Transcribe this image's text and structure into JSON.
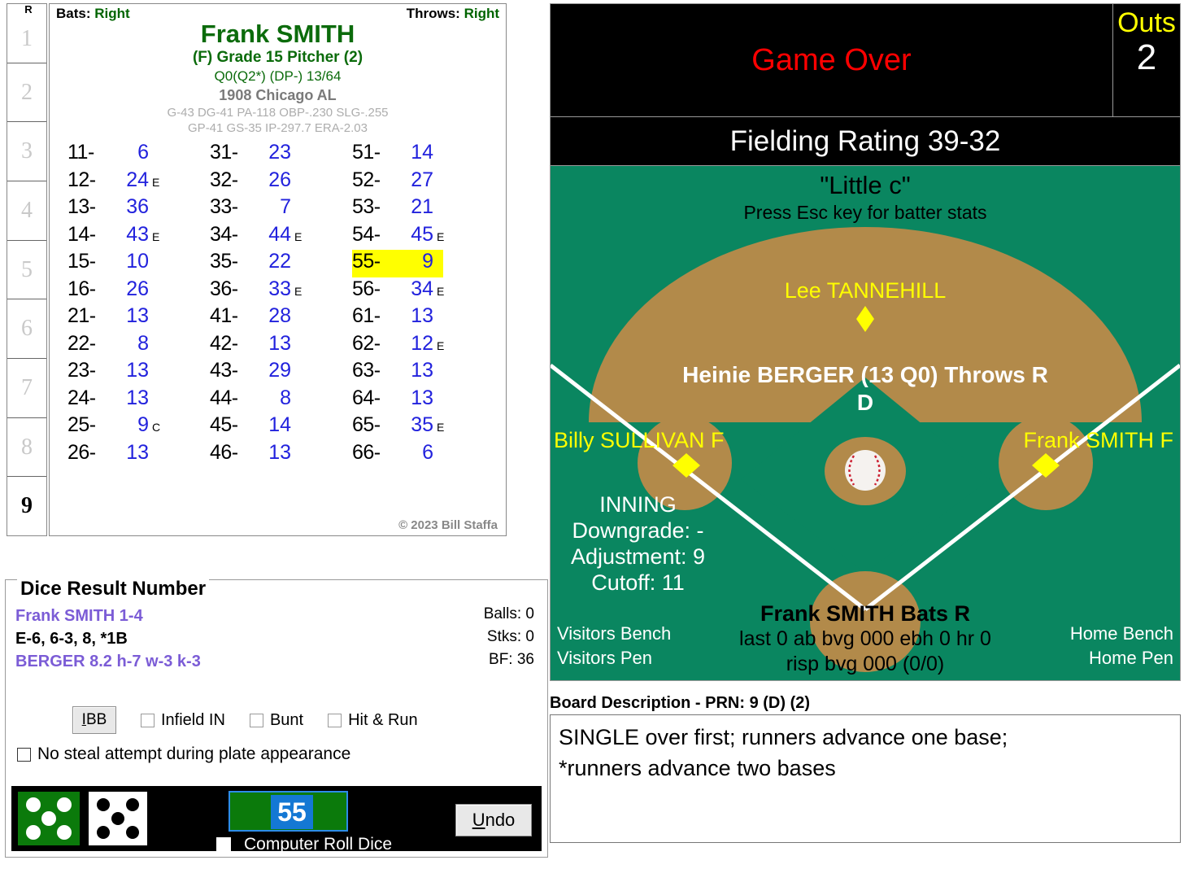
{
  "card": {
    "inning_header": "R",
    "innings": [
      "1",
      "2",
      "3",
      "4",
      "5",
      "6",
      "7",
      "8",
      "9"
    ],
    "current_inning": "9",
    "bats_label": "Bats:",
    "bats_value": "Right",
    "throws_label": "Throws:",
    "throws_value": "Right",
    "player_name": "Frank SMITH",
    "grade_line": "(F) Grade 15 Pitcher (2)",
    "q_line": "Q0(Q2*)  (DP-) 13/64",
    "team_line": "1908 Chicago AL",
    "stat_line_1": "G-43 DG-41 PA-118 OBP-.230 SLG-.255",
    "stat_line_2": "GP-41 GS-35 IP-297.7 ERA-2.03",
    "copyright": "© 2023 Bill Staffa",
    "columns": [
      [
        {
          "key": "11-",
          "value": "6",
          "suffix": ""
        },
        {
          "key": "12-",
          "value": "24",
          "suffix": "E"
        },
        {
          "key": "13-",
          "value": "36",
          "suffix": ""
        },
        {
          "key": "14-",
          "value": "43",
          "suffix": "E"
        },
        {
          "key": "15-",
          "value": "10",
          "suffix": ""
        },
        {
          "key": "16-",
          "value": "26",
          "suffix": ""
        },
        {
          "key": "21-",
          "value": "13",
          "suffix": ""
        },
        {
          "key": "22-",
          "value": "8",
          "suffix": ""
        },
        {
          "key": "23-",
          "value": "13",
          "suffix": ""
        },
        {
          "key": "24-",
          "value": "13",
          "suffix": ""
        },
        {
          "key": "25-",
          "value": "9",
          "suffix": "C"
        },
        {
          "key": "26-",
          "value": "13",
          "suffix": ""
        }
      ],
      [
        {
          "key": "31-",
          "value": "23",
          "suffix": ""
        },
        {
          "key": "32-",
          "value": "26",
          "suffix": ""
        },
        {
          "key": "33-",
          "value": "7",
          "suffix": ""
        },
        {
          "key": "34-",
          "value": "44",
          "suffix": "E"
        },
        {
          "key": "35-",
          "value": "22",
          "suffix": ""
        },
        {
          "key": "36-",
          "value": "33",
          "suffix": "E"
        },
        {
          "key": "41-",
          "value": "28",
          "suffix": ""
        },
        {
          "key": "42-",
          "value": "13",
          "suffix": ""
        },
        {
          "key": "43-",
          "value": "29",
          "suffix": ""
        },
        {
          "key": "44-",
          "value": "8",
          "suffix": ""
        },
        {
          "key": "45-",
          "value": "14",
          "suffix": ""
        },
        {
          "key": "46-",
          "value": "13",
          "suffix": ""
        }
      ],
      [
        {
          "key": "51-",
          "value": "14",
          "suffix": ""
        },
        {
          "key": "52-",
          "value": "27",
          "suffix": ""
        },
        {
          "key": "53-",
          "value": "21",
          "suffix": ""
        },
        {
          "key": "54-",
          "value": "45",
          "suffix": "E"
        },
        {
          "key": "55-",
          "value": "9",
          "suffix": "",
          "highlight": true
        },
        {
          "key": "56-",
          "value": "34",
          "suffix": "E"
        },
        {
          "key": "61-",
          "value": "13",
          "suffix": ""
        },
        {
          "key": "62-",
          "value": "12",
          "suffix": "E"
        },
        {
          "key": "63-",
          "value": "13",
          "suffix": ""
        },
        {
          "key": "64-",
          "value": "13",
          "suffix": ""
        },
        {
          "key": "65-",
          "value": "35",
          "suffix": "E"
        },
        {
          "key": "66-",
          "value": "6",
          "suffix": ""
        }
      ]
    ]
  },
  "dice_panel": {
    "title": "Dice Result Number",
    "line_batter": "Frank SMITH  1-4",
    "line_result": "E-6, 6-3, 8, *1B",
    "line_pitcher": "BERGER  8.2  h-7  w-3  k-3",
    "balls": "Balls: 0",
    "strikes": "Stks: 0",
    "bf": "BF: 36",
    "ibb_label": "IBB",
    "infield_in_label": "Infield IN",
    "bunt_label": "Bunt",
    "hit_run_label": "Hit & Run",
    "no_steal_label": "No steal attempt during plate appearance",
    "die_left_value": 5,
    "die_right_value": 5,
    "die_left_color": "#0b7a0b",
    "die_right_color": "#ffffff",
    "roll_number": "55",
    "computer_roll_label": "Computer Roll Dice",
    "undo_label": "Undo"
  },
  "scoreboard": {
    "status": "Game Over",
    "status_color": "#ff0000",
    "outs_label": "Outs",
    "outs_value": "2",
    "fielding_rating": "Fielding Rating 39-32"
  },
  "field": {
    "park_name": "\"Little c\"",
    "esc_hint": "Press Esc key for batter stats",
    "shortstop": "Lee TANNEHILL",
    "pitcher_line1": "Heinie BERGER (13 Q0) Throws R",
    "pitcher_line2": "D",
    "left_fielder": "Billy SULLIVAN F",
    "right_fielder": "Frank SMITH F",
    "inning_title": "INNING",
    "downgrade": "Downgrade: -",
    "adjustment": "Adjustment: 9",
    "cutoff": "Cutoff: 11",
    "batter_line": "Frank SMITH Bats R",
    "batter_stats_1": "last 0 ab bvg 000 ebh 0 hr 0",
    "batter_stats_2": "risp bvg 000 (0/0)",
    "visitors_bench": "Visitors Bench",
    "visitors_pen": "Visitors Pen",
    "home_bench": "Home Bench",
    "home_pen": "Home Pen",
    "grass_color": "#0a8660",
    "dirt_color": "#b28a4a"
  },
  "board": {
    "title": "Board Description - PRN: 9 (D) (2)",
    "line1": "SINGLE over first; runners advance one base;",
    "line2": "*runners advance two bases"
  }
}
